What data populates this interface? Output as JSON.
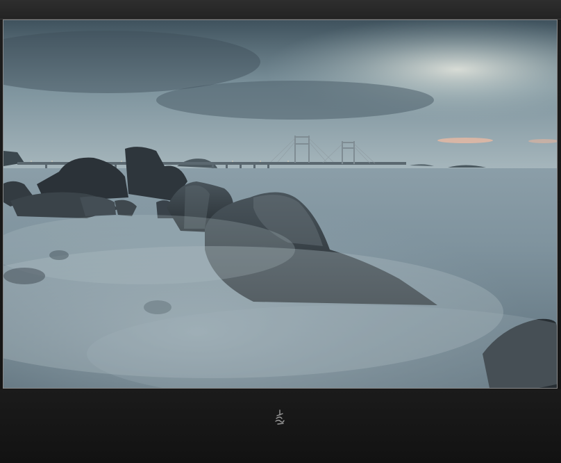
{
  "photo": {
    "subject": "",
    "colors": {
      "sky_top": "#3c4f5a",
      "sky_mid": "#8fa4ad",
      "sky_glow": "#d8dfd8",
      "sunset": "#e6b9a4",
      "sea": "#8fa1ab",
      "mist": "#a9b8c0",
      "rock": "#2a3137"
    }
  },
  "frame": {
    "background": "#141414",
    "border": "#8a8a8a"
  },
  "signature": {
    "icon": "signature-mark-icon"
  }
}
